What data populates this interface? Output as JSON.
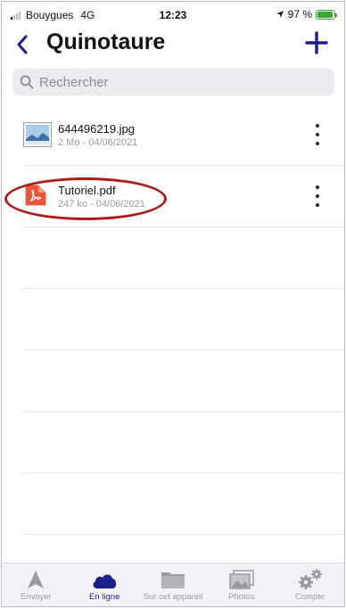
{
  "status_bar": {
    "carrier": "Bouygues",
    "network": "4G",
    "time": "12:23",
    "battery": "97 %"
  },
  "header": {
    "title": "Quinotaure"
  },
  "search": {
    "placeholder": "Rechercher"
  },
  "files": [
    {
      "name": "644496219.jpg",
      "meta": "2 Mo - 04/06/2021",
      "icon": "image-file-icon"
    },
    {
      "name": "Tutoriel.pdf",
      "meta": "247 ko - 04/06/2021",
      "icon": "pdf-file-icon"
    }
  ],
  "tabs": [
    {
      "label": "Envoyer",
      "icon": "send-icon",
      "active": false
    },
    {
      "label": "En ligne",
      "icon": "cloud-icon",
      "active": true
    },
    {
      "label": "Sur cet appareil",
      "icon": "folder-icon",
      "active": false
    },
    {
      "label": "Photos",
      "icon": "photos-icon",
      "active": false
    },
    {
      "label": "Compte",
      "icon": "gears-icon",
      "active": false
    }
  ],
  "colors": {
    "accent": "#1a1f8c",
    "highlight": "#b01818",
    "pdf": "#e8553a"
  }
}
